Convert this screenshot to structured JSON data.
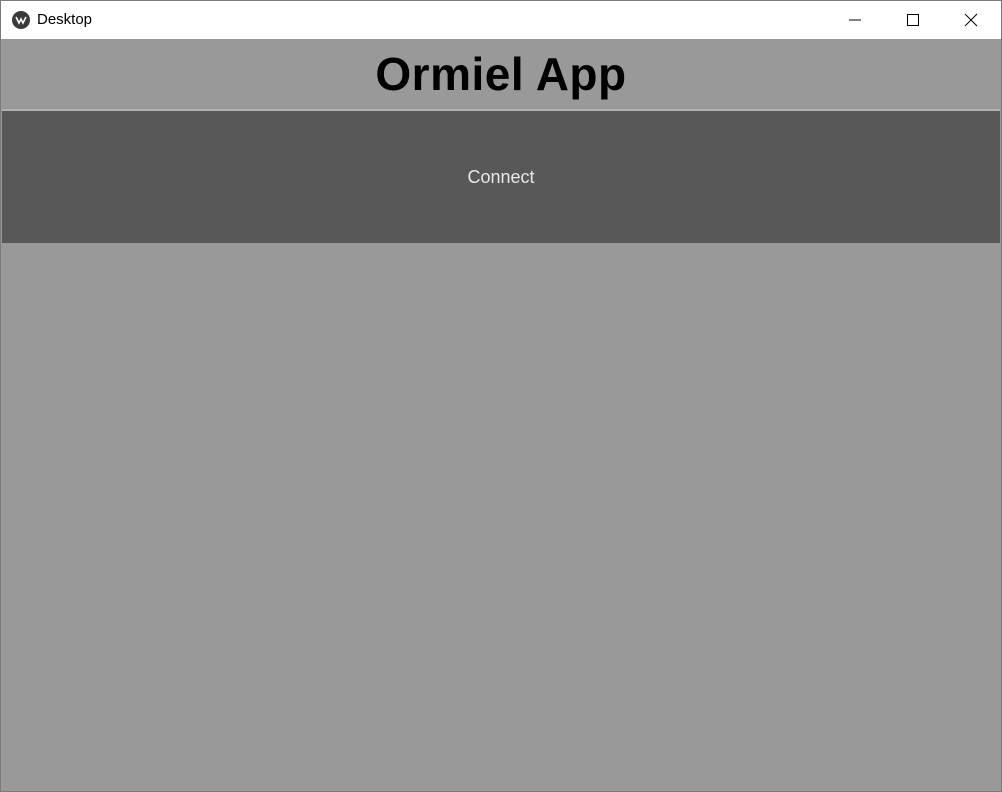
{
  "window": {
    "title": "Desktop",
    "icon": "kivy-app-icon",
    "controls": [
      "minimize-icon",
      "maximize-icon",
      "close-icon"
    ]
  },
  "main": {
    "app_title": "Ormiel App",
    "connect_label": "Connect"
  },
  "colors": {
    "background": "#999999",
    "button": "#585858",
    "button_text": "#e8e8e8",
    "title_text": "#000000"
  }
}
